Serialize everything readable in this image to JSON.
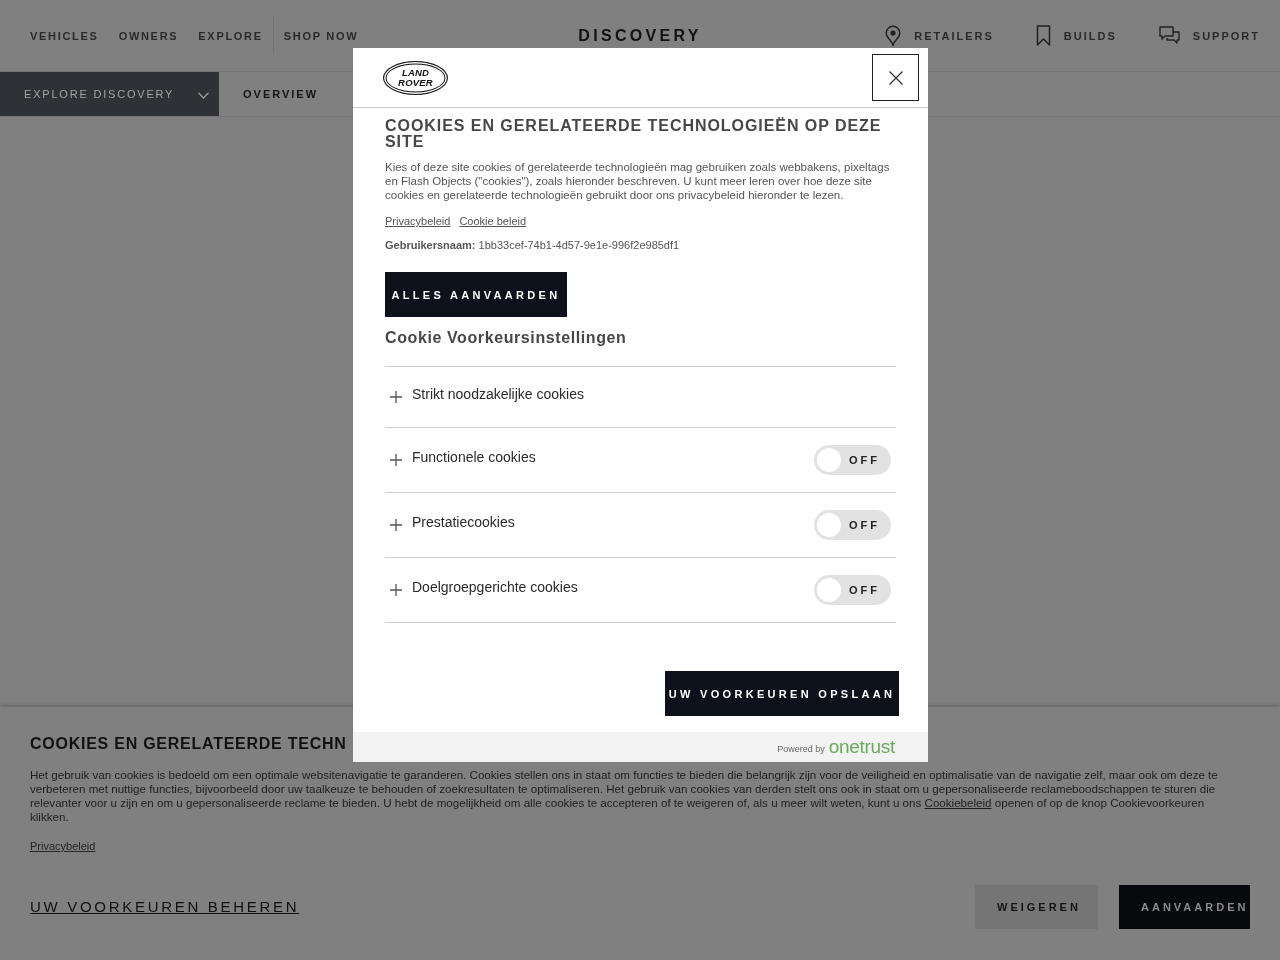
{
  "header": {
    "nav": [
      "VEHICLES",
      "OWNERS",
      "EXPLORE"
    ],
    "shop_link": "SHOP NOW",
    "wordmark": "DISCOVERY",
    "utilities": [
      {
        "label": "RETAILERS"
      },
      {
        "label": "BUILDS"
      },
      {
        "label": "SUPPORT"
      }
    ]
  },
  "subnav": {
    "dropdown": "EXPLORE DISCOVERY",
    "items": [
      "OVERVIEW"
    ]
  },
  "modal": {
    "logo": [
      "LAND",
      "ROVER"
    ],
    "title": "COOKIES EN GERELATEERDE TECHNOLOGIEËN OP DEZE SITE",
    "description": "Kies of deze site cookies of gerelateerde technologieën mag gebruiken zoals webbakens, pixeltags en Flash Objects (\"cookies\"), zoals hieronder beschreven. U kunt meer leren over hoe deze site cookies en gerelateerde technologieën gebruikt door ons privacybeleid hieronder te lezen.",
    "links": [
      "Privacybeleid",
      "Cookie beleid"
    ],
    "user_id": "**Gebruikersnaam:** 1bb33cef-74b1-4d57-9e1e-996f2e985df1",
    "accept_all": "ALLES AANVAARDEN",
    "preferences_heading": "Cookie Voorkeursinstellingen",
    "categories": [
      {
        "kind": "fixed",
        "label": "Strikt noodzakelijke cookies",
        "expanded": false
      },
      {
        "kind": "toggle",
        "label": "Functionele cookies",
        "expanded": false,
        "on": false,
        "state_label": "OFF"
      },
      {
        "kind": "toggle",
        "label": "Prestatiecookies",
        "expanded": false,
        "on": false,
        "state_label": "OFF"
      },
      {
        "kind": "toggle",
        "label": "Doelgroepgerichte cookies",
        "expanded": false,
        "on": false,
        "state_label": "OFF"
      }
    ],
    "save": "UW VOORKEUREN OPSLAAN",
    "powered_by": "Powered by",
    "powered_brand": "onetrust"
  },
  "banner": {
    "title": "COOKIES EN GERELATEERDE TECHN",
    "text_before": "Het gebruik van cookies is bedoeld om een optimale websitenavigatie te garanderen. Cookies stellen ons in staat om functies te bieden die belangrijk zijn voor de veiligheid en optimalisatie van de navigatie zelf, maar ook om deze te verbeteren met nuttige functies, bijvoorbeeld door uw taalkeuze te behouden of zoekresultaten te optimaliseren. Het gebruik van cookies van derden stelt ons ook in staat om u gepersonaliseerde reclameboodschappen te sturen die relevanter voor u zijn en om u gepersonaliseerde reclame te bieden. U hebt de mogelijkheid om alle cookies te accepteren of te weigeren of, als u meer wilt weten, kunt u ons ",
    "policy_link": "Cookiebeleid",
    "text_after": " openen of op de knop Cookievoorkeuren klikken.",
    "privacy_link": "Privacybeleid",
    "manage_link": "UW VOORKEUREN BEHEREN",
    "buttons": [
      {
        "kind": "secondary",
        "label": "WEIGEREN"
      },
      {
        "kind": "primary",
        "label": "AANVAARDEN"
      }
    ]
  }
}
